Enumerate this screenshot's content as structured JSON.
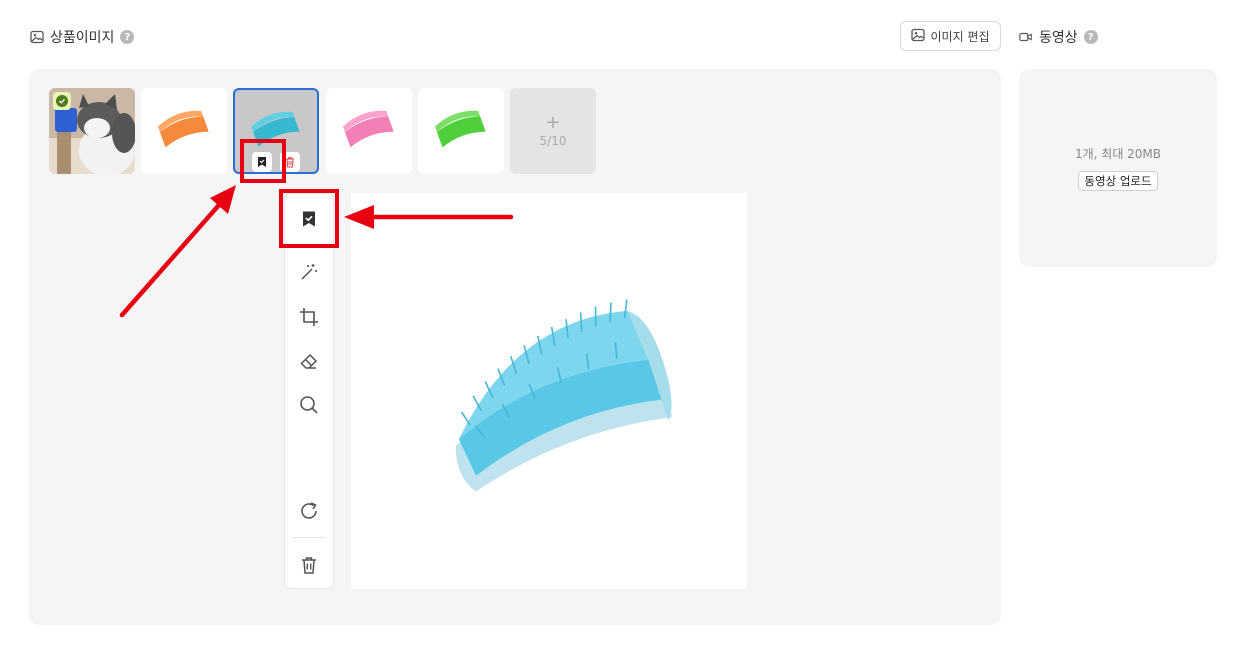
{
  "product_images": {
    "title": "상품이미지",
    "help": "?",
    "edit_button": "이미지 편집",
    "thumbnails": [
      {
        "name": "cat-with-blue-brush",
        "color": "#2f5fd0"
      },
      {
        "name": "orange-brush",
        "color": "#f58a3a"
      },
      {
        "name": "blue-brush",
        "color": "#36b8cf"
      },
      {
        "name": "pink-brush",
        "color": "#f27fb5"
      },
      {
        "name": "green-brush",
        "color": "#4fcf3a"
      }
    ],
    "add_slot": {
      "plus": "+",
      "count": "5/10"
    },
    "toolbar_tools": [
      "representative-icon",
      "magic-wand-icon",
      "crop-icon",
      "eraser-icon",
      "zoom-icon",
      "rotate-icon",
      "trash-icon"
    ]
  },
  "video": {
    "title": "동영상",
    "help": "?",
    "info": "1개, 최대 20MB",
    "upload_button": "동영상 업로드"
  },
  "colors": {
    "selection_border": "#2d6bd6",
    "annotation_red": "#e60012",
    "preview_product": "#59c7e6"
  }
}
